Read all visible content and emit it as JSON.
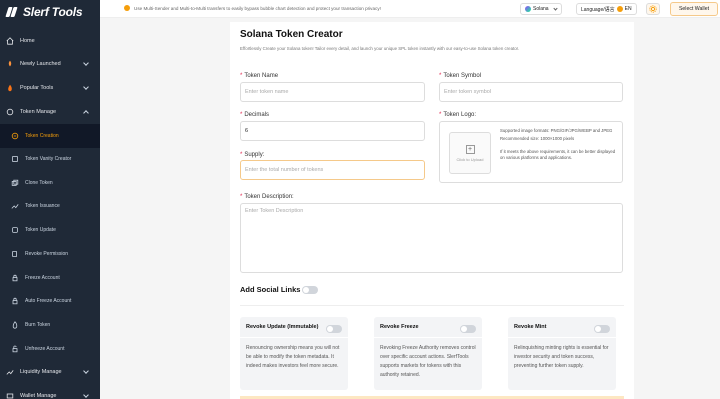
{
  "app": {
    "name": "Slerf Tools"
  },
  "sidebar": {
    "items": [
      {
        "label": "Home",
        "icon": "home-icon",
        "expandable": false
      },
      {
        "label": "Newly Launched",
        "icon": "rocket-icon",
        "expandable": true
      },
      {
        "label": "Popular Tools",
        "icon": "fire-icon",
        "expandable": true
      },
      {
        "label": "Token Manage",
        "icon": "token-icon",
        "expandable": true
      },
      {
        "label": "Token Creation",
        "icon": "coin-icon",
        "active": true
      },
      {
        "label": "Token Vanity Creator",
        "icon": "vanity-icon"
      },
      {
        "label": "Clone Token",
        "icon": "clone-icon"
      },
      {
        "label": "Token Issuance",
        "icon": "issuance-icon"
      },
      {
        "label": "Token Update",
        "icon": "update-icon"
      },
      {
        "label": "Revoke Permission",
        "icon": "revoke-icon"
      },
      {
        "label": "Freeze Account",
        "icon": "freeze-icon"
      },
      {
        "label": "Auto Freeze Account",
        "icon": "auto-freeze-icon"
      },
      {
        "label": "Burn Token",
        "icon": "burn-icon"
      },
      {
        "label": "Unfreeze Account",
        "icon": "unfreeze-icon"
      },
      {
        "label": "Liquidity Manage",
        "icon": "liquidity-icon",
        "expandable": true
      },
      {
        "label": "Wallet Manage",
        "icon": "wallet-icon",
        "expandable": true
      }
    ]
  },
  "topbar": {
    "notice": "Use Multi-Sender and Multi-to-Multi transfers to easily bypass bubble chart detection and protect your transaction privacy!",
    "network": "Solana",
    "language_label": "Language/语言",
    "language_code": "EN",
    "wallet_button": "Select Wallet"
  },
  "form": {
    "title": "Solana Token Creator",
    "subtitle": "Effortlessly Create your Solana token! Tailor every detail, and launch your unique SPL token instantly with our easy-to-use Solana token creator.",
    "token_name": {
      "label": "Token Name",
      "placeholder": "Enter token name"
    },
    "token_symbol": {
      "label": "Token Symbol",
      "placeholder": "Enter token symbol"
    },
    "decimals": {
      "label": "Decimals",
      "value": "6"
    },
    "supply": {
      "label": "Supply:",
      "placeholder": "Enter the total number of tokens"
    },
    "token_logo": {
      "label": "Token Logo:",
      "upload_text": "Click to Upload",
      "formats": "Supported image formats: PNG/GIF/JPG/WEBP and JPEG",
      "size": "Recommended size: 1000×1000 pixels",
      "note": "If it meets the above requirements, it can be better displayed on various platforms and applications."
    },
    "description": {
      "label": "Token Description:",
      "placeholder": "Enter Token Description"
    },
    "social_links": {
      "label": "Add Social Links"
    }
  },
  "revoke": [
    {
      "title": "Revoke Update (Immutable)",
      "desc": "Renouncing ownership means you will not be able to modify the token metadata. It indeed makes investors feel more secure."
    },
    {
      "title": "Revoke Freeze",
      "desc": "Revoking Freeze Authority removes control over specific account actions. SlerfTools supports markets for tokens with this authority retained."
    },
    {
      "title": "Revoke Mint",
      "desc": "Relinquishing minting rights is essential for investor security and token success, preventing further token supply."
    }
  ],
  "colors": {
    "sidebar_bg": "#1f2937",
    "accent": "#f59e0b"
  }
}
